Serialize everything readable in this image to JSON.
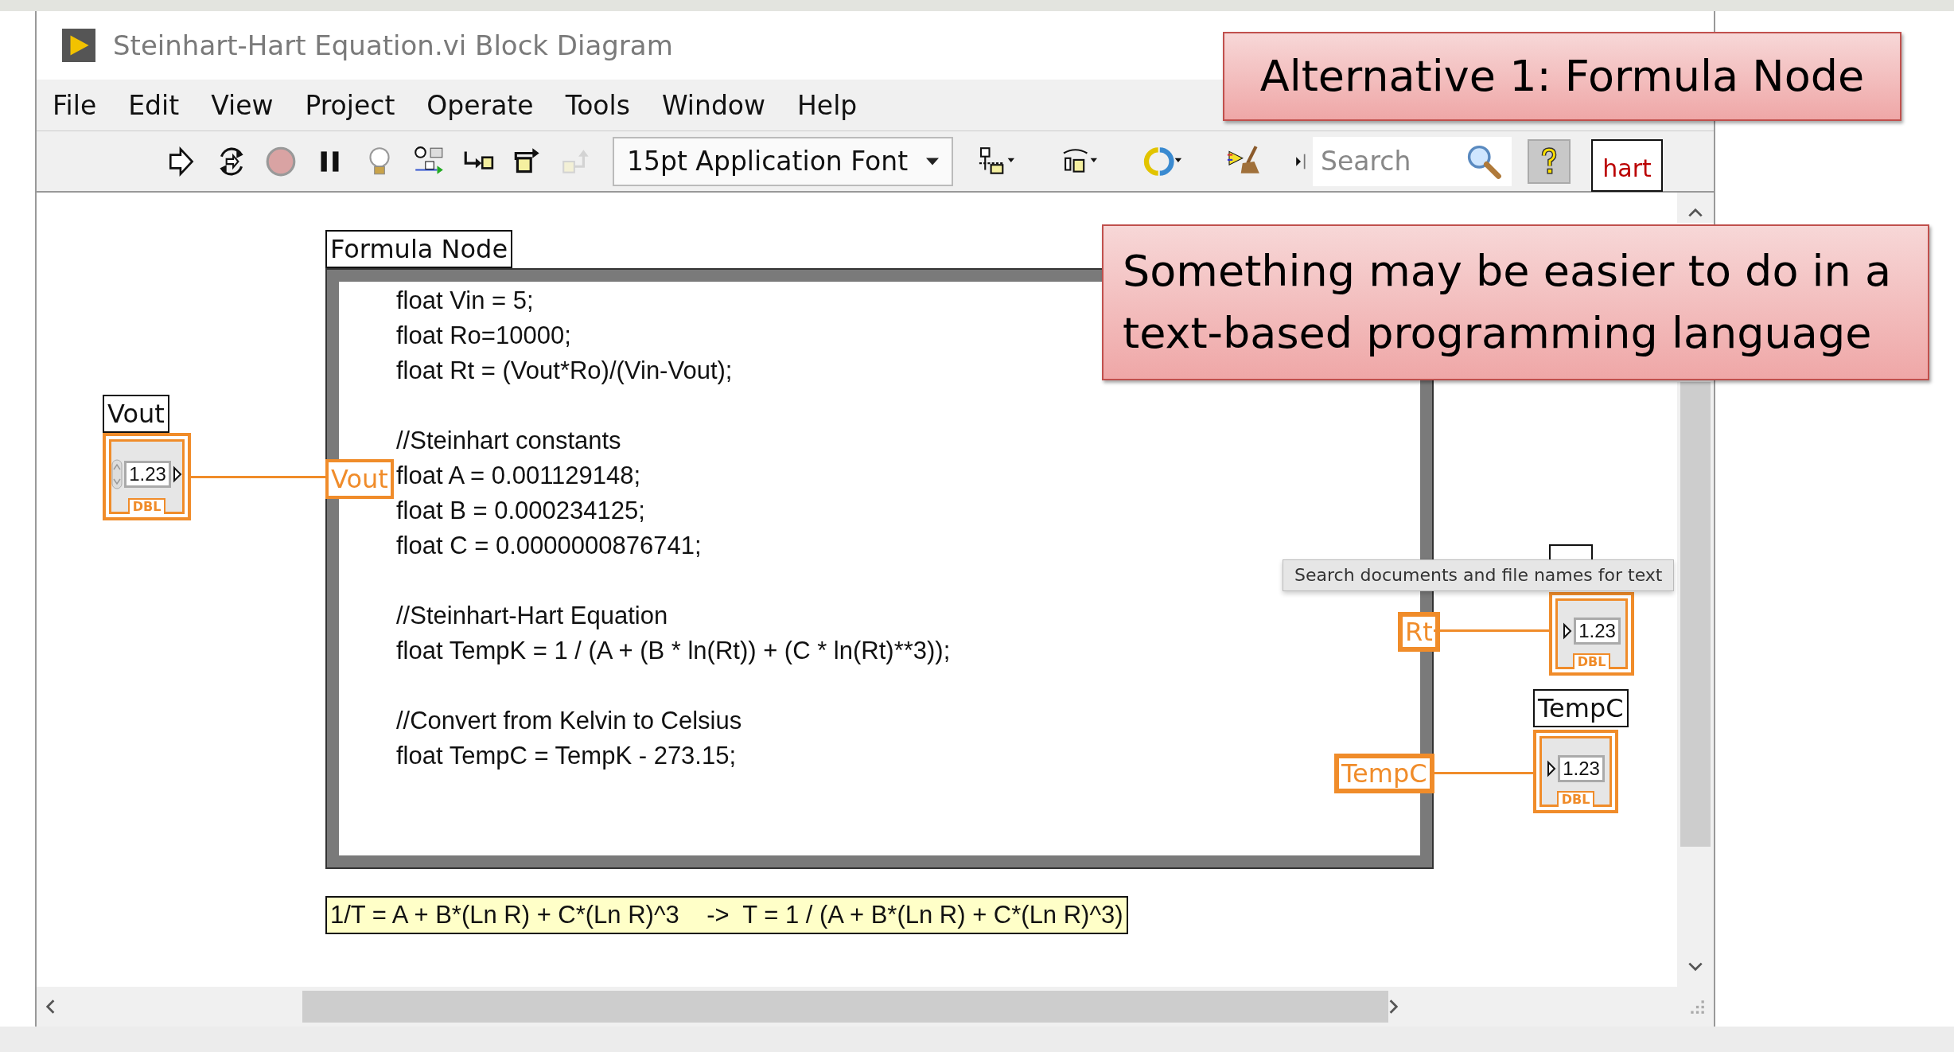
{
  "window": {
    "title": "Steinhart-Hart Equation.vi Block Diagram"
  },
  "menu": [
    "File",
    "Edit",
    "View",
    "Project",
    "Operate",
    "Tools",
    "Window",
    "Help"
  ],
  "toolbar": {
    "tools": [
      {
        "kind": "run",
        "disabled": false
      },
      {
        "kind": "run-continuous",
        "disabled": false
      },
      {
        "kind": "abort",
        "disabled": false
      },
      {
        "kind": "pause",
        "disabled": false
      },
      {
        "kind": "highlight",
        "disabled": false
      },
      {
        "kind": "retain",
        "disabled": false
      },
      {
        "kind": "step-into",
        "disabled": false
      },
      {
        "kind": "step-over",
        "disabled": false
      },
      {
        "kind": "step-out",
        "disabled": true
      }
    ],
    "font_dropdown": "15pt Application Font",
    "arrange": [
      {
        "kind": "align"
      },
      {
        "kind": "distribute"
      },
      {
        "kind": "reorder"
      },
      {
        "kind": "cleanup"
      }
    ],
    "search": {
      "placeholder": "Search"
    }
  },
  "vi_icon": {
    "text": "hart"
  },
  "diagram": {
    "formula_node": {
      "label": "Formula Node",
      "code": [
        [
          "float Vin = 5;",
          "float Ro=10000;",
          "float Rt = (Vout*Ro)/(Vin-Vout);"
        ],
        [
          "//Steinhart constants",
          "float A = 0.001129148;",
          "float B = 0.000234125;",
          "float C = 0.0000000876741;"
        ],
        [
          "//Steinhart-Hart Equation",
          "float TempK = 1 / (A + (B * ln(Rt)) + (C * ln(Rt)**3));"
        ],
        [
          "//Convert from Kelvin to Celsius",
          "float TempC = TempK - 273.15;"
        ]
      ],
      "inputs": [
        "Vout"
      ],
      "outputs": [
        "Rt",
        "TempC"
      ]
    },
    "terminals": [
      {
        "kind": "control",
        "label": "Vout",
        "value": "1.23",
        "type": "DBL"
      },
      {
        "kind": "indicator",
        "value": "1.23",
        "type": "DBL"
      },
      {
        "kind": "indicator",
        "label": "TempC",
        "value": "1.23",
        "type": "DBL"
      }
    ],
    "comment": "1/T = A + B*(Ln R) + C*(Ln R)^3    ->  T = 1 / (A + B*(Ln R) + C*(Ln R)^3)"
  },
  "tooltip": "Search documents and file names for text",
  "callouts": [
    "Alternative 1: Formula Node",
    "Something may be easier to do in a text-based programming language"
  ]
}
